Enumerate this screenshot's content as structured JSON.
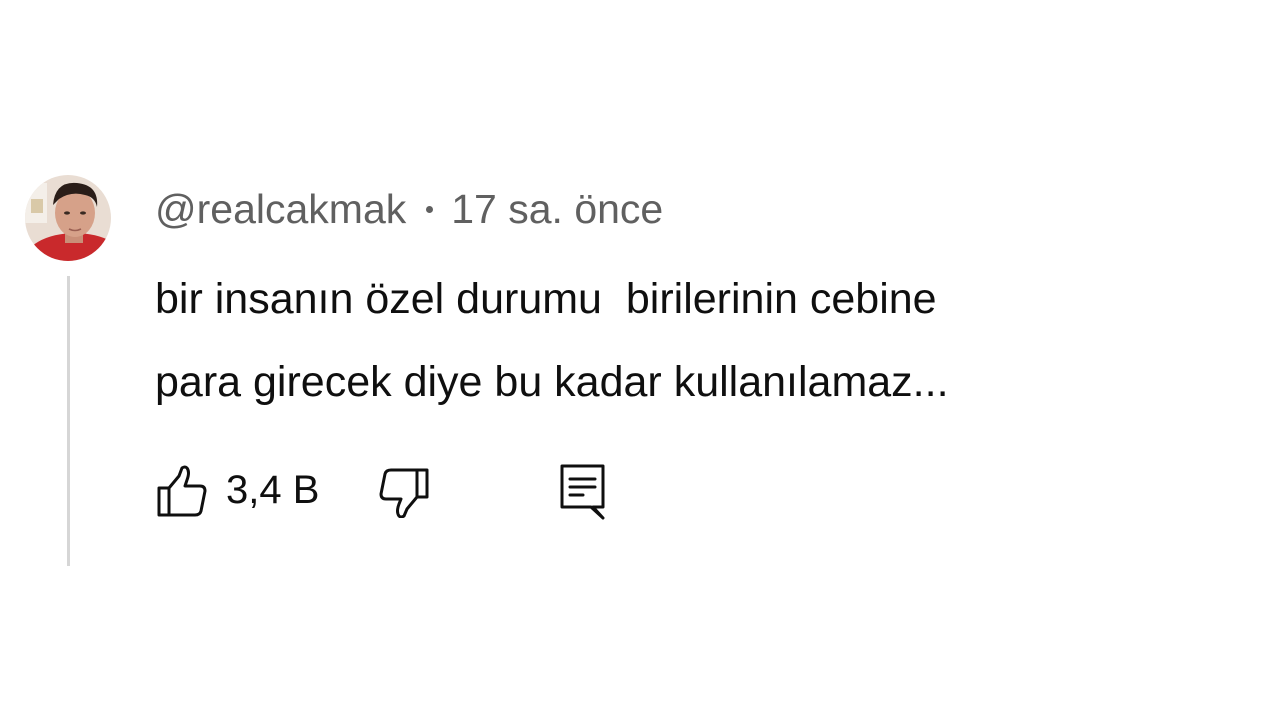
{
  "comment": {
    "author_handle": "@realcakmak",
    "timestamp": "17 sa. önce",
    "text_lines": [
      "bir insanın özel durumu  birilerinin cebine",
      "para girecek diye bu kadar kullanılamaz..."
    ],
    "like_count": "3,4 B"
  },
  "icons": {
    "like": "thumbs-up-icon",
    "dislike": "thumbs-down-icon",
    "reply": "comment-reply-icon"
  },
  "colors": {
    "background": "#ffffff",
    "meta_text": "#606060",
    "body_text": "#0f0f0f",
    "thread_line": "#d6d6d6"
  }
}
